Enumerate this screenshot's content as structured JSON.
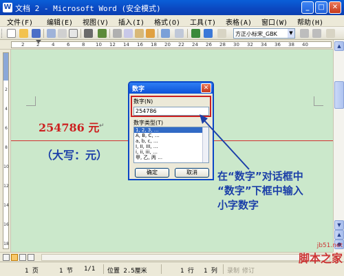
{
  "window": {
    "title": "文档 2 - Microsoft Word (安全模式)",
    "min": "_",
    "max": "□",
    "close": "✕"
  },
  "menu": [
    "文件(F)",
    "编辑(E)",
    "视图(V)",
    "插入(I)",
    "格式(O)",
    "工具(T)",
    "表格(A)",
    "窗口(W)",
    "帮助(H)"
  ],
  "toolbar": {
    "font": "方正小标宋_GBK"
  },
  "ruler": {
    "numbers": [
      "2",
      "2",
      "4",
      "6",
      "8",
      "10",
      "12",
      "14",
      "16",
      "18",
      "20",
      "22",
      "24",
      "26",
      "28",
      "30",
      "32",
      "34",
      "36",
      "38",
      "40"
    ]
  },
  "vruler": {
    "numbers": [
      "2",
      "4",
      "6",
      "8",
      "10",
      "12",
      "14",
      "16",
      "18"
    ]
  },
  "document": {
    "amount": "254786 元",
    "para_mark": "↵",
    "caps": "（大写：元）"
  },
  "dialog": {
    "title": "数字",
    "number_label": "数字(N)",
    "number_value": "254786",
    "type_label": "数字类型(T)",
    "types": [
      "1, 2, 3, …",
      "A, B, C, …",
      "a, b, c, …",
      "I, II, III, …",
      "i, ii, iii, …",
      "甲, 乙, 丙 …"
    ],
    "ok": "确定",
    "cancel": "取消",
    "close": "✕"
  },
  "annotation": [
    "在“数字”对话框中",
    "“数字”下框中输入",
    "小字数字"
  ],
  "status": {
    "page": "1 页",
    "section": "1 节",
    "pages": "1/1",
    "position": "位置 2.5厘米",
    "line": "1 行",
    "col": "1 列",
    "rec": "录制",
    "mod": "修订"
  },
  "watermark": {
    "site": "jb51.net",
    "name": "脚本之家"
  },
  "colors": {
    "document_bg": "#cbe8cb",
    "amount": "#cc1f1f",
    "annotation": "#1b3fa8"
  }
}
